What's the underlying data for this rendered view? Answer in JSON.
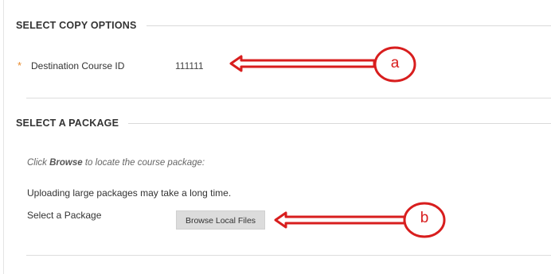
{
  "copy_options": {
    "title": "SELECT COPY OPTIONS",
    "required_mark": "*",
    "destination_label": "Destination Course ID",
    "destination_value": "111111"
  },
  "package": {
    "title": "SELECT A PACKAGE",
    "instruction_prefix": "Click ",
    "instruction_bold": "Browse",
    "instruction_suffix": " to locate the course package:",
    "warning": "Uploading large packages may take a long time.",
    "select_label": "Select a Package",
    "browse_button": "Browse Local Files"
  },
  "annotations": {
    "callout_a": "a",
    "callout_b": "b",
    "color": "#d81e1e"
  }
}
